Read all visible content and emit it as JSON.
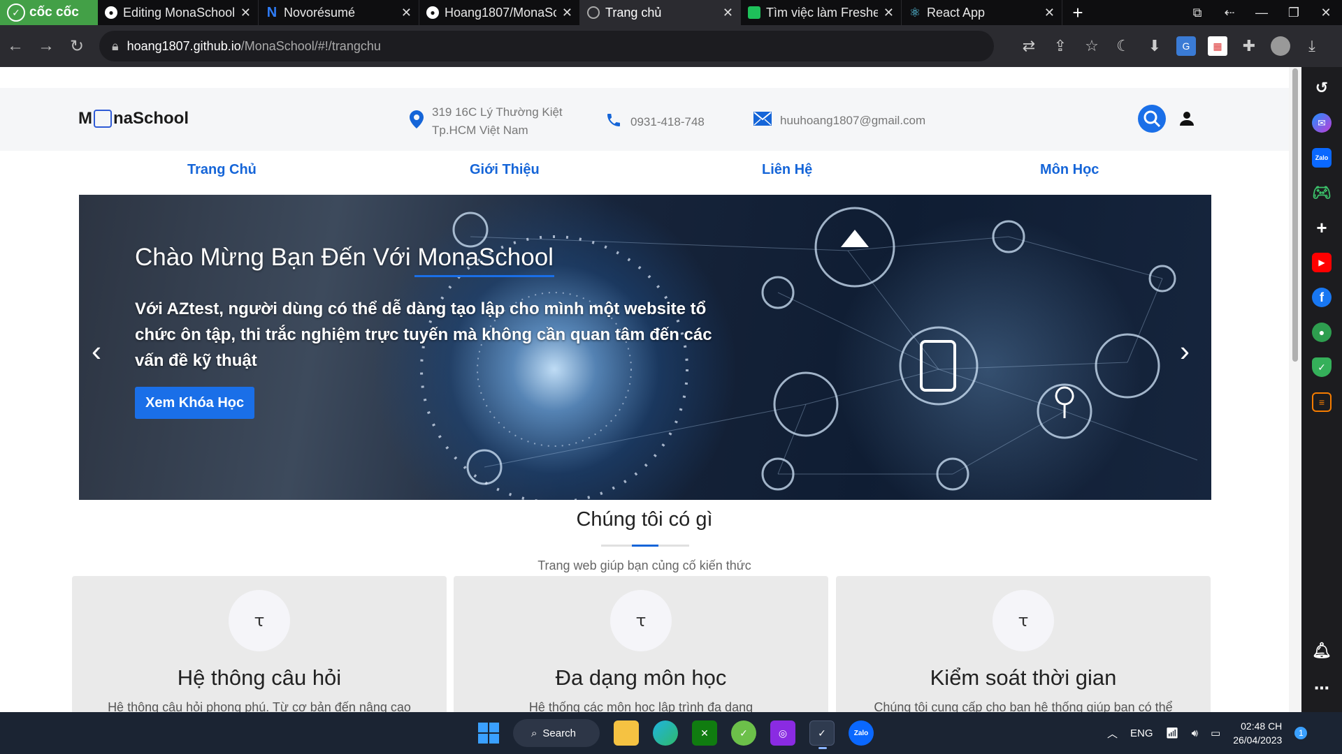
{
  "browser": {
    "brand": "cốc cốc",
    "tabs": [
      {
        "title": "Editing MonaSchool",
        "icon": "github-icon"
      },
      {
        "title": "Novorésumé",
        "icon": "novoresume-icon"
      },
      {
        "title": "Hoang1807/MonaSc",
        "icon": "github-icon"
      },
      {
        "title": "Trang chủ",
        "icon": "globe-icon",
        "active": true
      },
      {
        "title": "Tìm việc làm Freshe",
        "icon": "topcv-icon"
      },
      {
        "title": "React App",
        "icon": "react-icon"
      }
    ],
    "url_host": "hoang1807.github.io",
    "url_path": "/MonaSchool/#!/trangchu"
  },
  "header": {
    "logo": {
      "pre": "M",
      "post": "naSchool"
    },
    "address_line1": "319 16C Lý Thường Kiệt",
    "address_line2": "Tp.HCM Việt Nam",
    "phone": "0931-418-748",
    "email": "huuhoang1807@gmail.com"
  },
  "menu": [
    "Trang Chủ",
    "Giới Thiệu",
    "Liên Hệ",
    "Môn Học"
  ],
  "banner": {
    "title": "Chào Mừng Bạn Đến Với MonaSchool",
    "text": "Với AZtest, người dùng có thể dễ dàng tạo lập cho mình một website tổ chức ôn tập, thi trắc nghiệm trực tuyến mà không cần quan tâm đến các vấn đề kỹ thuật",
    "button": "Xem Khóa Học"
  },
  "section": {
    "title": "Chúng tôi có gì",
    "subtitle": "Trang web giúp bạn củng cố kiến thức"
  },
  "cards": [
    {
      "title": "Hệ thông câu hỏi",
      "desc": "Hệ thông câu hỏi phong phú. Từ cơ bản đến nâng cao"
    },
    {
      "title": "Đa dạng môn học",
      "desc": "Hệ thống các môn học lập trình đa dạng"
    },
    {
      "title": "Kiểm soát thời gian",
      "desc": "Chúng tôi cung cấp cho bạn hệ thống giúp bạn có thể"
    }
  ],
  "taskbar": {
    "search": "Search",
    "lang": "ENG",
    "time": "02:48 CH",
    "date": "26/04/2023",
    "notif_count": "1"
  },
  "colors": {
    "accent": "#1565d8",
    "button": "#1a6fe8",
    "brand_green": "#43a047"
  }
}
